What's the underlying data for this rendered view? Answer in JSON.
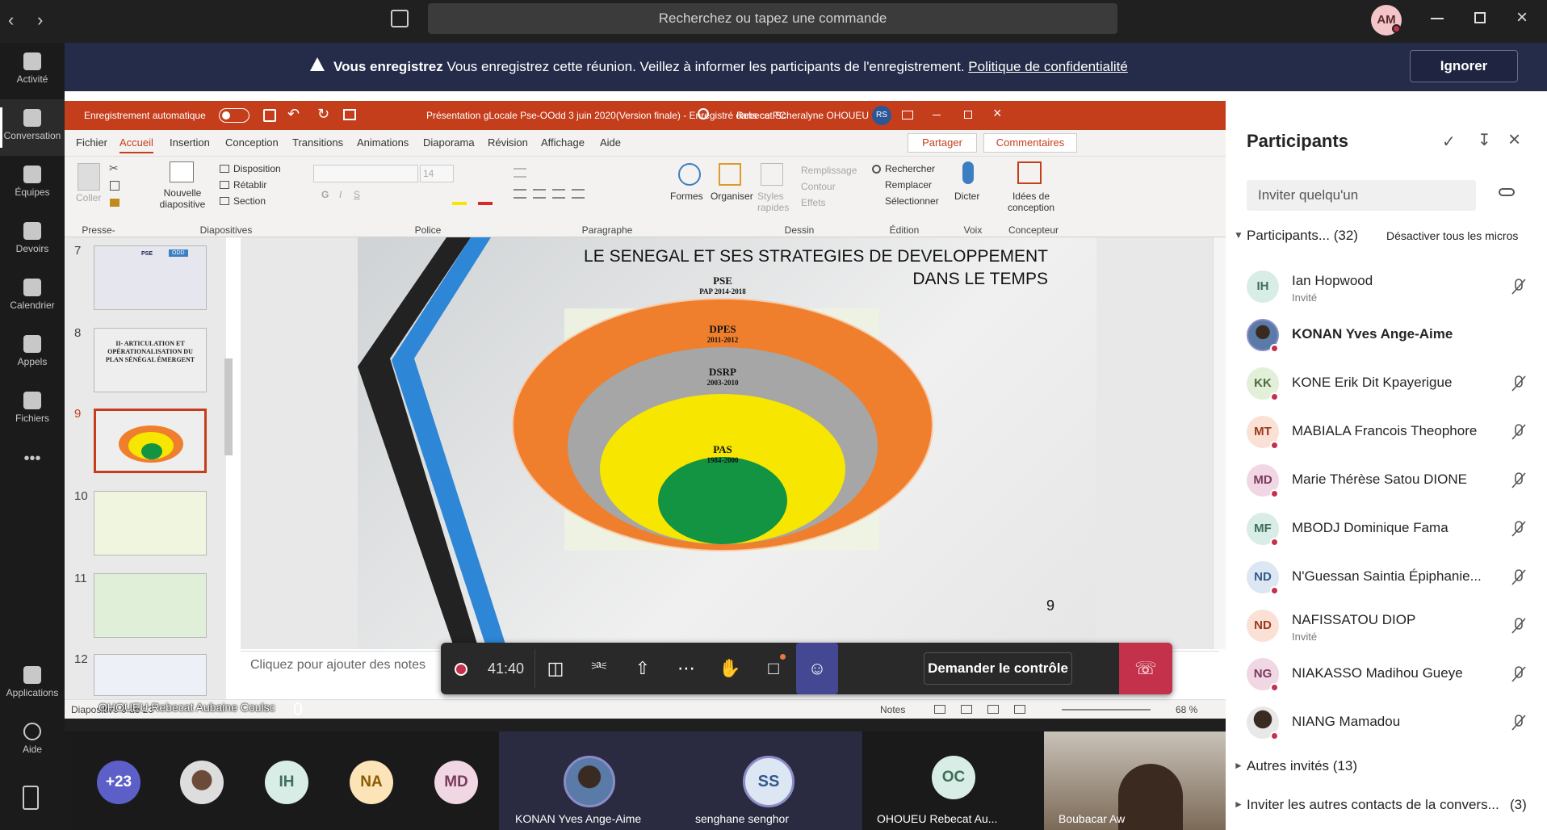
{
  "teams": {
    "search_placeholder": "Recherchez ou tapez une commande",
    "user_initials": "AM",
    "rail": [
      {
        "label": "Activité",
        "icon": "bell-icon"
      },
      {
        "label": "Conversation",
        "icon": "chat-icon"
      },
      {
        "label": "Équipes",
        "icon": "teams-icon"
      },
      {
        "label": "Devoirs",
        "icon": "assignments-icon"
      },
      {
        "label": "Calendrier",
        "icon": "calendar-icon"
      },
      {
        "label": "Appels",
        "icon": "phone-icon"
      },
      {
        "label": "Fichiers",
        "icon": "files-icon"
      },
      {
        "label": "Applications",
        "icon": "apps-icon"
      },
      {
        "label": "Aide",
        "icon": "help-icon"
      }
    ],
    "more_label": "•••"
  },
  "banner": {
    "bold": "Vous enregistrez",
    "text": "Vous enregistrez cette réunion. Veillez à informer les participants de l'enregistrement.",
    "link": "Politique de confidentialité",
    "button": "Ignorer"
  },
  "powerpoint": {
    "autosave": "Enregistrement automatique",
    "doc_title": "Présentation gLocale Pse-OOdd 3 juin 2020(Version finale)  -  Enregistré dans ce PC",
    "user": "Rebecat Scheralyne OHOUEU",
    "user_initials": "RS",
    "menu": [
      "Fichier",
      "Accueil",
      "Insertion",
      "Conception",
      "Transitions",
      "Animations",
      "Diaporama",
      "Révision",
      "Affichage",
      "Aide"
    ],
    "share": "Partager",
    "comments": "Commentaires",
    "ribbon": {
      "paste": "Coller",
      "new_slide": "Nouvelle diapositive",
      "layout": "Disposition",
      "reset": "Rétablir",
      "section": "Section",
      "font_size": "14",
      "shapes": "Formes",
      "arrange": "Organiser",
      "styles": "Styles rapides",
      "fill": "Remplissage",
      "outline": "Contour",
      "effects": "Effets",
      "find": "Rechercher",
      "replace": "Remplacer",
      "select": "Sélectionner",
      "dictate": "Dicter",
      "ideas": "Idées de conception",
      "groups": [
        "Presse-papiers",
        "Diapositives",
        "Police",
        "Paragraphe",
        "Dessin",
        "Édition",
        "Voix",
        "Concepteur"
      ]
    },
    "thumb_numbers": [
      "7",
      "8",
      "9",
      "10",
      "11",
      "12"
    ],
    "thumb8_text": "II- ARTICULATION ET OPÉRATIONALISATION DU PLAN SÉNÉGAL ÉMERGENT",
    "thumb7_labels": [
      "PSE",
      "ODD"
    ],
    "slide": {
      "title_line1": "LE SENEGAL ET SES STRATEGIES DE DEVELOPPEMENT",
      "title_line2": "DANS LE TEMPS",
      "rings": [
        {
          "name": "PSE",
          "years": "PAP 2014-2018",
          "color": "#ef7f2d"
        },
        {
          "name": "DPES",
          "years": "2011-2012",
          "color": "#a6a6a6"
        },
        {
          "name": "DSRP",
          "years": "2003-2010",
          "color": "#f7e600"
        },
        {
          "name": "PAS",
          "years": "1984-2000",
          "color": "#129443"
        }
      ],
      "page_number": "9"
    },
    "notes_placeholder": "Cliquez pour ajouter des notes",
    "status_left": "Diapositive 9 de 23",
    "status_notes": "Notes",
    "zoom": "68 %"
  },
  "call": {
    "timer": "41:40",
    "request_control": "Demander le contrôle",
    "presenter_label": "OHOUEU Rebecat Aubaine Coulsc"
  },
  "gallery": [
    {
      "initials": "+23",
      "color": "#5b5fc7",
      "text_color": "#ffffff"
    },
    {
      "initials": "",
      "photo": true
    },
    {
      "initials": "IH",
      "color": "#d8ede5",
      "text_color": "#3f6e5b"
    },
    {
      "initials": "NA",
      "color": "#fce4b8",
      "text_color": "#8a5a00"
    },
    {
      "initials": "MD",
      "color": "#f1d6e4",
      "text_color": "#7b3b5e"
    }
  ],
  "tiles": [
    {
      "name": "KONAN Yves Ange-Aime",
      "initials": ""
    },
    {
      "name": "senghane senghor",
      "initials": "SS"
    },
    {
      "name": "OHOUEU Rebecat Au...",
      "initials": "OC"
    },
    {
      "name": "Boubacar Aw",
      "initials": ""
    }
  ],
  "panel": {
    "title": "Participants",
    "invite_placeholder": "Inviter quelqu'un",
    "section": "Participants... (32)",
    "mute_all": "Désactiver tous les micros",
    "participants": [
      {
        "initials": "IH",
        "name": "Ian Hopwood",
        "sub": "Invité",
        "bg": "#d8ede5",
        "fg": "#3f6e5b",
        "dot": false
      },
      {
        "initials": "",
        "name": "KONAN Yves Ange-Aime",
        "sub": "",
        "bg": "#3b5a84",
        "fg": "#ffffff",
        "dot": true,
        "bold": true
      },
      {
        "initials": "KK",
        "name": "KONE Erik Dit Kpayerigue",
        "sub": "",
        "bg": "#e2efd9",
        "fg": "#4d6b3b",
        "dot": true
      },
      {
        "initials": "MT",
        "name": "MABIALA Francois Theophore",
        "sub": "",
        "bg": "#fbe0d6",
        "fg": "#9b3b1b",
        "dot": true
      },
      {
        "initials": "MD",
        "name": "Marie Thérèse Satou DIONE",
        "sub": "",
        "bg": "#f1d6e4",
        "fg": "#7b3b5e",
        "dot": true
      },
      {
        "initials": "MF",
        "name": "MBODJ Dominique Fama",
        "sub": "",
        "bg": "#d8ede5",
        "fg": "#3f6e5b",
        "dot": true
      },
      {
        "initials": "ND",
        "name": "N'Guessan Saintia Épiphanie...",
        "sub": "",
        "bg": "#dde6f3",
        "fg": "#345a8c",
        "dot": true
      },
      {
        "initials": "ND",
        "name": "NAFISSATOU DIOP",
        "sub": "Invité",
        "bg": "#fbe0d6",
        "fg": "#9b3b1b",
        "dot": false
      },
      {
        "initials": "NG",
        "name": "NIAKASSO Madihou Gueye",
        "sub": "",
        "bg": "#f1d6e4",
        "fg": "#7b3b5e",
        "dot": true
      },
      {
        "initials": "",
        "name": "NIANG Mamadou",
        "sub": "",
        "bg": "#3a2b22",
        "fg": "#ffffff",
        "dot": true
      }
    ],
    "other_invited": "Autres invités (13)",
    "invite_others": "Inviter les autres contacts de la convers...",
    "invite_others_count": "(3)"
  }
}
